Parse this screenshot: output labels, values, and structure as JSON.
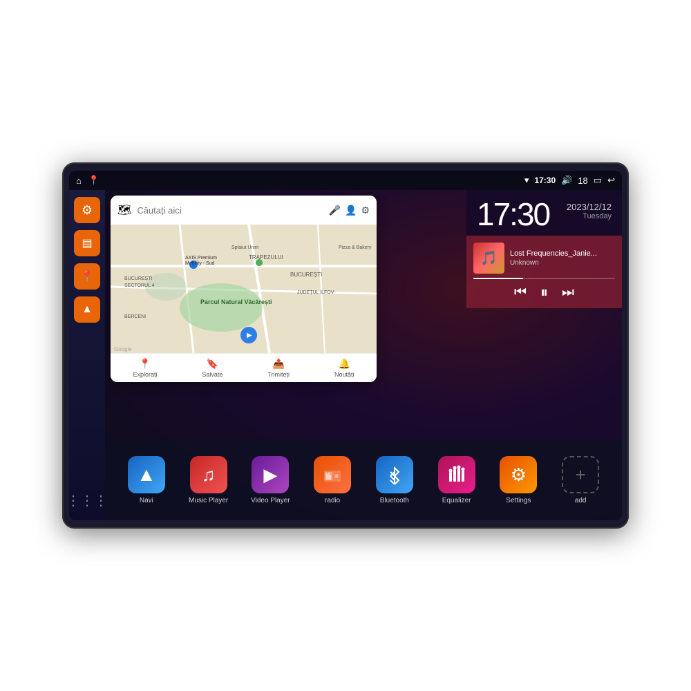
{
  "device": {
    "status_bar": {
      "left_icons": [
        "home",
        "location"
      ],
      "wifi_icon": "wifi",
      "time": "17:30",
      "volume_icon": "volume",
      "battery_level": "18",
      "battery_icon": "battery",
      "back_icon": "back"
    },
    "clock": {
      "time": "17:30",
      "date": "2023/12/12",
      "day": "Tuesday"
    },
    "music": {
      "title": "Lost Frequencies_Janie...",
      "artist": "Unknown"
    },
    "map": {
      "search_placeholder": "Căutați aici",
      "footer_items": [
        {
          "icon": "📍",
          "label": "Explorați"
        },
        {
          "icon": "🔖",
          "label": "Salvate"
        },
        {
          "icon": "📤",
          "label": "Trimiteți"
        },
        {
          "icon": "🔔",
          "label": "Noutăți"
        }
      ]
    },
    "sidebar": {
      "items": [
        {
          "icon": "⚙",
          "label": "settings"
        },
        {
          "icon": "▤",
          "label": "drawer"
        },
        {
          "icon": "📍",
          "label": "map"
        },
        {
          "icon": "▲",
          "label": "navigation"
        }
      ],
      "bottom": {
        "icon": "⋮⋮⋮",
        "label": "grid"
      }
    },
    "apps": [
      {
        "id": "navi",
        "label": "Navi",
        "icon": "▲",
        "color": "icon-navi"
      },
      {
        "id": "music-player",
        "label": "Music Player",
        "icon": "♫",
        "color": "icon-music"
      },
      {
        "id": "video-player",
        "label": "Video Player",
        "icon": "▶",
        "color": "icon-video"
      },
      {
        "id": "radio",
        "label": "radio",
        "icon": "📻",
        "color": "icon-radio"
      },
      {
        "id": "bluetooth",
        "label": "Bluetooth",
        "icon": "✦",
        "color": "icon-bluetooth"
      },
      {
        "id": "equalizer",
        "label": "Equalizer",
        "icon": "≋",
        "color": "icon-equalizer"
      },
      {
        "id": "settings",
        "label": "Settings",
        "icon": "⚙",
        "color": "icon-settings"
      },
      {
        "id": "add",
        "label": "add",
        "icon": "+",
        "color": "icon-add"
      }
    ]
  }
}
